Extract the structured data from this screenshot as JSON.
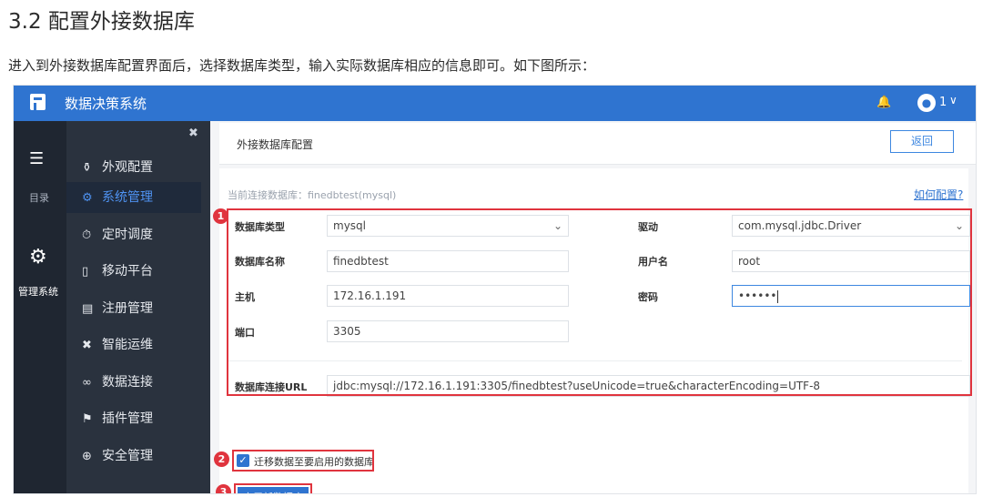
{
  "doc": {
    "title": "3.2 配置外接数据库",
    "intro": "进入到外接数据库配置界面后，选择数据库类型，输入实际数据库相应的信息即可。如下图所示："
  },
  "app": {
    "title": "数据决策系统",
    "user_number": "1",
    "user_caret": "∨"
  },
  "iconbar": {
    "menu_label": "目录",
    "manage_label": "管理系统"
  },
  "subnav": {
    "items": [
      {
        "label": "外观配置",
        "icon": "palette-icon"
      },
      {
        "label": "系统管理",
        "icon": "gear-icon"
      },
      {
        "label": "定时调度",
        "icon": "timer-icon"
      },
      {
        "label": "移动平台",
        "icon": "mobile-icon"
      },
      {
        "label": "注册管理",
        "icon": "register-icon"
      },
      {
        "label": "智能运维",
        "icon": "nodes-icon"
      },
      {
        "label": "数据连接",
        "icon": "link-icon"
      },
      {
        "label": "插件管理",
        "icon": "puzzle-icon"
      },
      {
        "label": "安全管理",
        "icon": "shield-icon"
      }
    ]
  },
  "panel": {
    "title": "外接数据库配置",
    "back_label": "返回",
    "current_db": "当前连接数据库：finedbtest(mysql)",
    "howto": "如何配置?"
  },
  "form": {
    "db_type_label": "数据库类型",
    "db_type_value": "mysql",
    "driver_label": "驱动",
    "driver_value": "com.mysql.jdbc.Driver",
    "db_name_label": "数据库名称",
    "db_name_value": "finedbtest",
    "username_label": "用户名",
    "username_value": "root",
    "host_label": "主机",
    "host_value": "172.16.1.191",
    "password_label": "密码",
    "password_value": "••••••",
    "port_label": "端口",
    "port_value": "3305",
    "url_label": "数据库连接URL",
    "url_value": "jdbc:mysql://172.16.1.191:3305/finedbtest?useUnicode=true&characterEncoding=UTF-8"
  },
  "migrate": {
    "label": "迁移数据至要启用的数据库",
    "checked": true
  },
  "enable_button": "启用新数据库",
  "annotations": {
    "badge1": "1",
    "badge2": "2",
    "badge3": "3",
    "color": "#e0343e"
  },
  "colors": {
    "topbar": "#2f74d0",
    "iconbar": "#1f2631",
    "subnav": "#2a323e",
    "active_text": "#4f93f2"
  }
}
